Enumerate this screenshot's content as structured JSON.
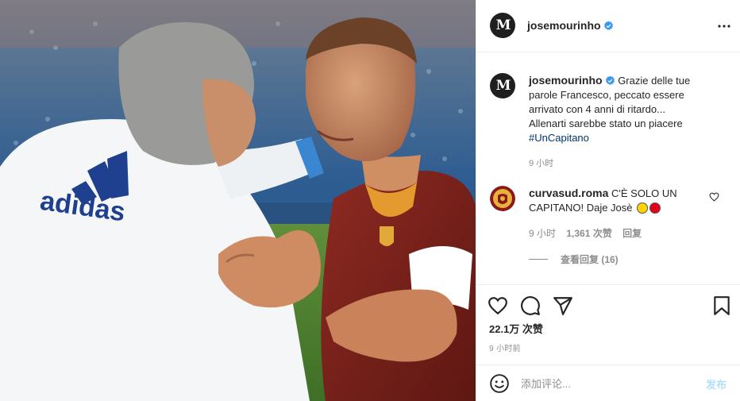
{
  "post": {
    "username": "josemourinho",
    "avatar_letter": "M",
    "caption_lines": [
      "Grazie delle tue",
      "parole Francesco, peccato essere",
      "arrivato con 4 anni di ritardo...",
      "Allenarti sarebbe stato un piacere"
    ],
    "hashtag": "#UnCapitano",
    "caption_time": "9 小时"
  },
  "photo": {
    "description_free": true,
    "shirt_brand": "adidas"
  },
  "comment": {
    "username": "curvasud.roma",
    "text": "C'È SOLO UN CAPITANO! Daje Josè",
    "time": "9 小时",
    "likes": "1,361 次赞",
    "reply_label": "回复",
    "view_replies": "查看回复 (16)"
  },
  "actions": {
    "likes_count": "22.1万 次赞",
    "posted_ago": "9 小时前"
  },
  "add_comment": {
    "placeholder": "添加评论...",
    "post_label": "发布"
  },
  "colors": {
    "verified": "#3897f0",
    "hashtag": "#00376b",
    "post_button_disabled": "#b2dffc",
    "dot_yellow": "#ffd400",
    "dot_red": "#e3001b"
  },
  "icons": [
    "verified-badge-icon",
    "more-options-icon",
    "heart-icon",
    "comment-icon",
    "share-icon",
    "bookmark-icon",
    "emoji-icon"
  ]
}
